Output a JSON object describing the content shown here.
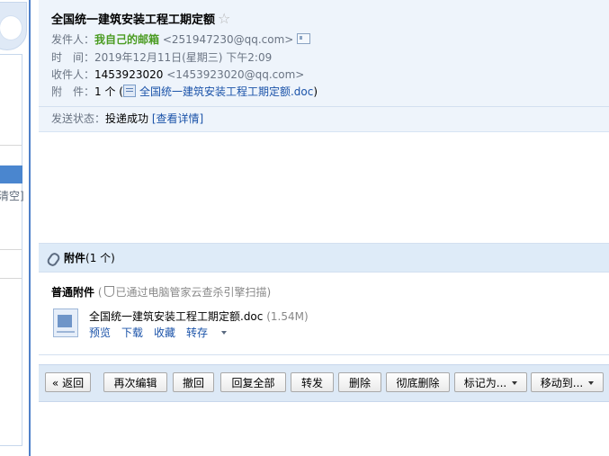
{
  "sidebar": {
    "clear_label": "清空]"
  },
  "email": {
    "subject": "全国统一建筑安装工程工期定额",
    "star_glyph": "☆",
    "from_label": "发件人：",
    "from_name": "我自己的邮箱",
    "from_address": "<251947230@qq.com>",
    "time_label": "时　间：",
    "time_value": "2019年12月11日(星期三) 下午2:09",
    "to_label": "收件人：",
    "to_name": "1453923020",
    "to_address": "<1453923020@qq.com>",
    "attach_label": "附　件：",
    "attach_count": "1 个 (",
    "attach_file": "全国统一建筑安装工程工期定额.doc",
    "attach_close": ")",
    "status_label": "发送状态：",
    "status_value": "投递成功",
    "status_link": "[查看详情]"
  },
  "attachments": {
    "title": "附件",
    "count": "(1 个)",
    "normal_label": "普通附件",
    "scan_open": "(",
    "scan_text": "已通过电脑管家云查杀引擎扫描)",
    "file_name": "全国统一建筑安装工程工期定额.doc",
    "file_size": "(1.54M)",
    "actions": {
      "preview": "预览",
      "download": "下载",
      "favorite": "收藏",
      "save": "转存"
    }
  },
  "toolbar": {
    "back": "« 返回",
    "reedit": "再次编辑",
    "recall": "撤回",
    "reply_all": "回复全部",
    "forward": "转发",
    "delete": "删除",
    "delete_forever": "彻底删除",
    "mark_as": "标记为...",
    "move_to": "移动到..."
  },
  "icons": [
    "star-icon",
    "contact-card-icon",
    "doc-file-icon",
    "paperclip-icon",
    "shield-icon",
    "chevron-down-icon"
  ]
}
